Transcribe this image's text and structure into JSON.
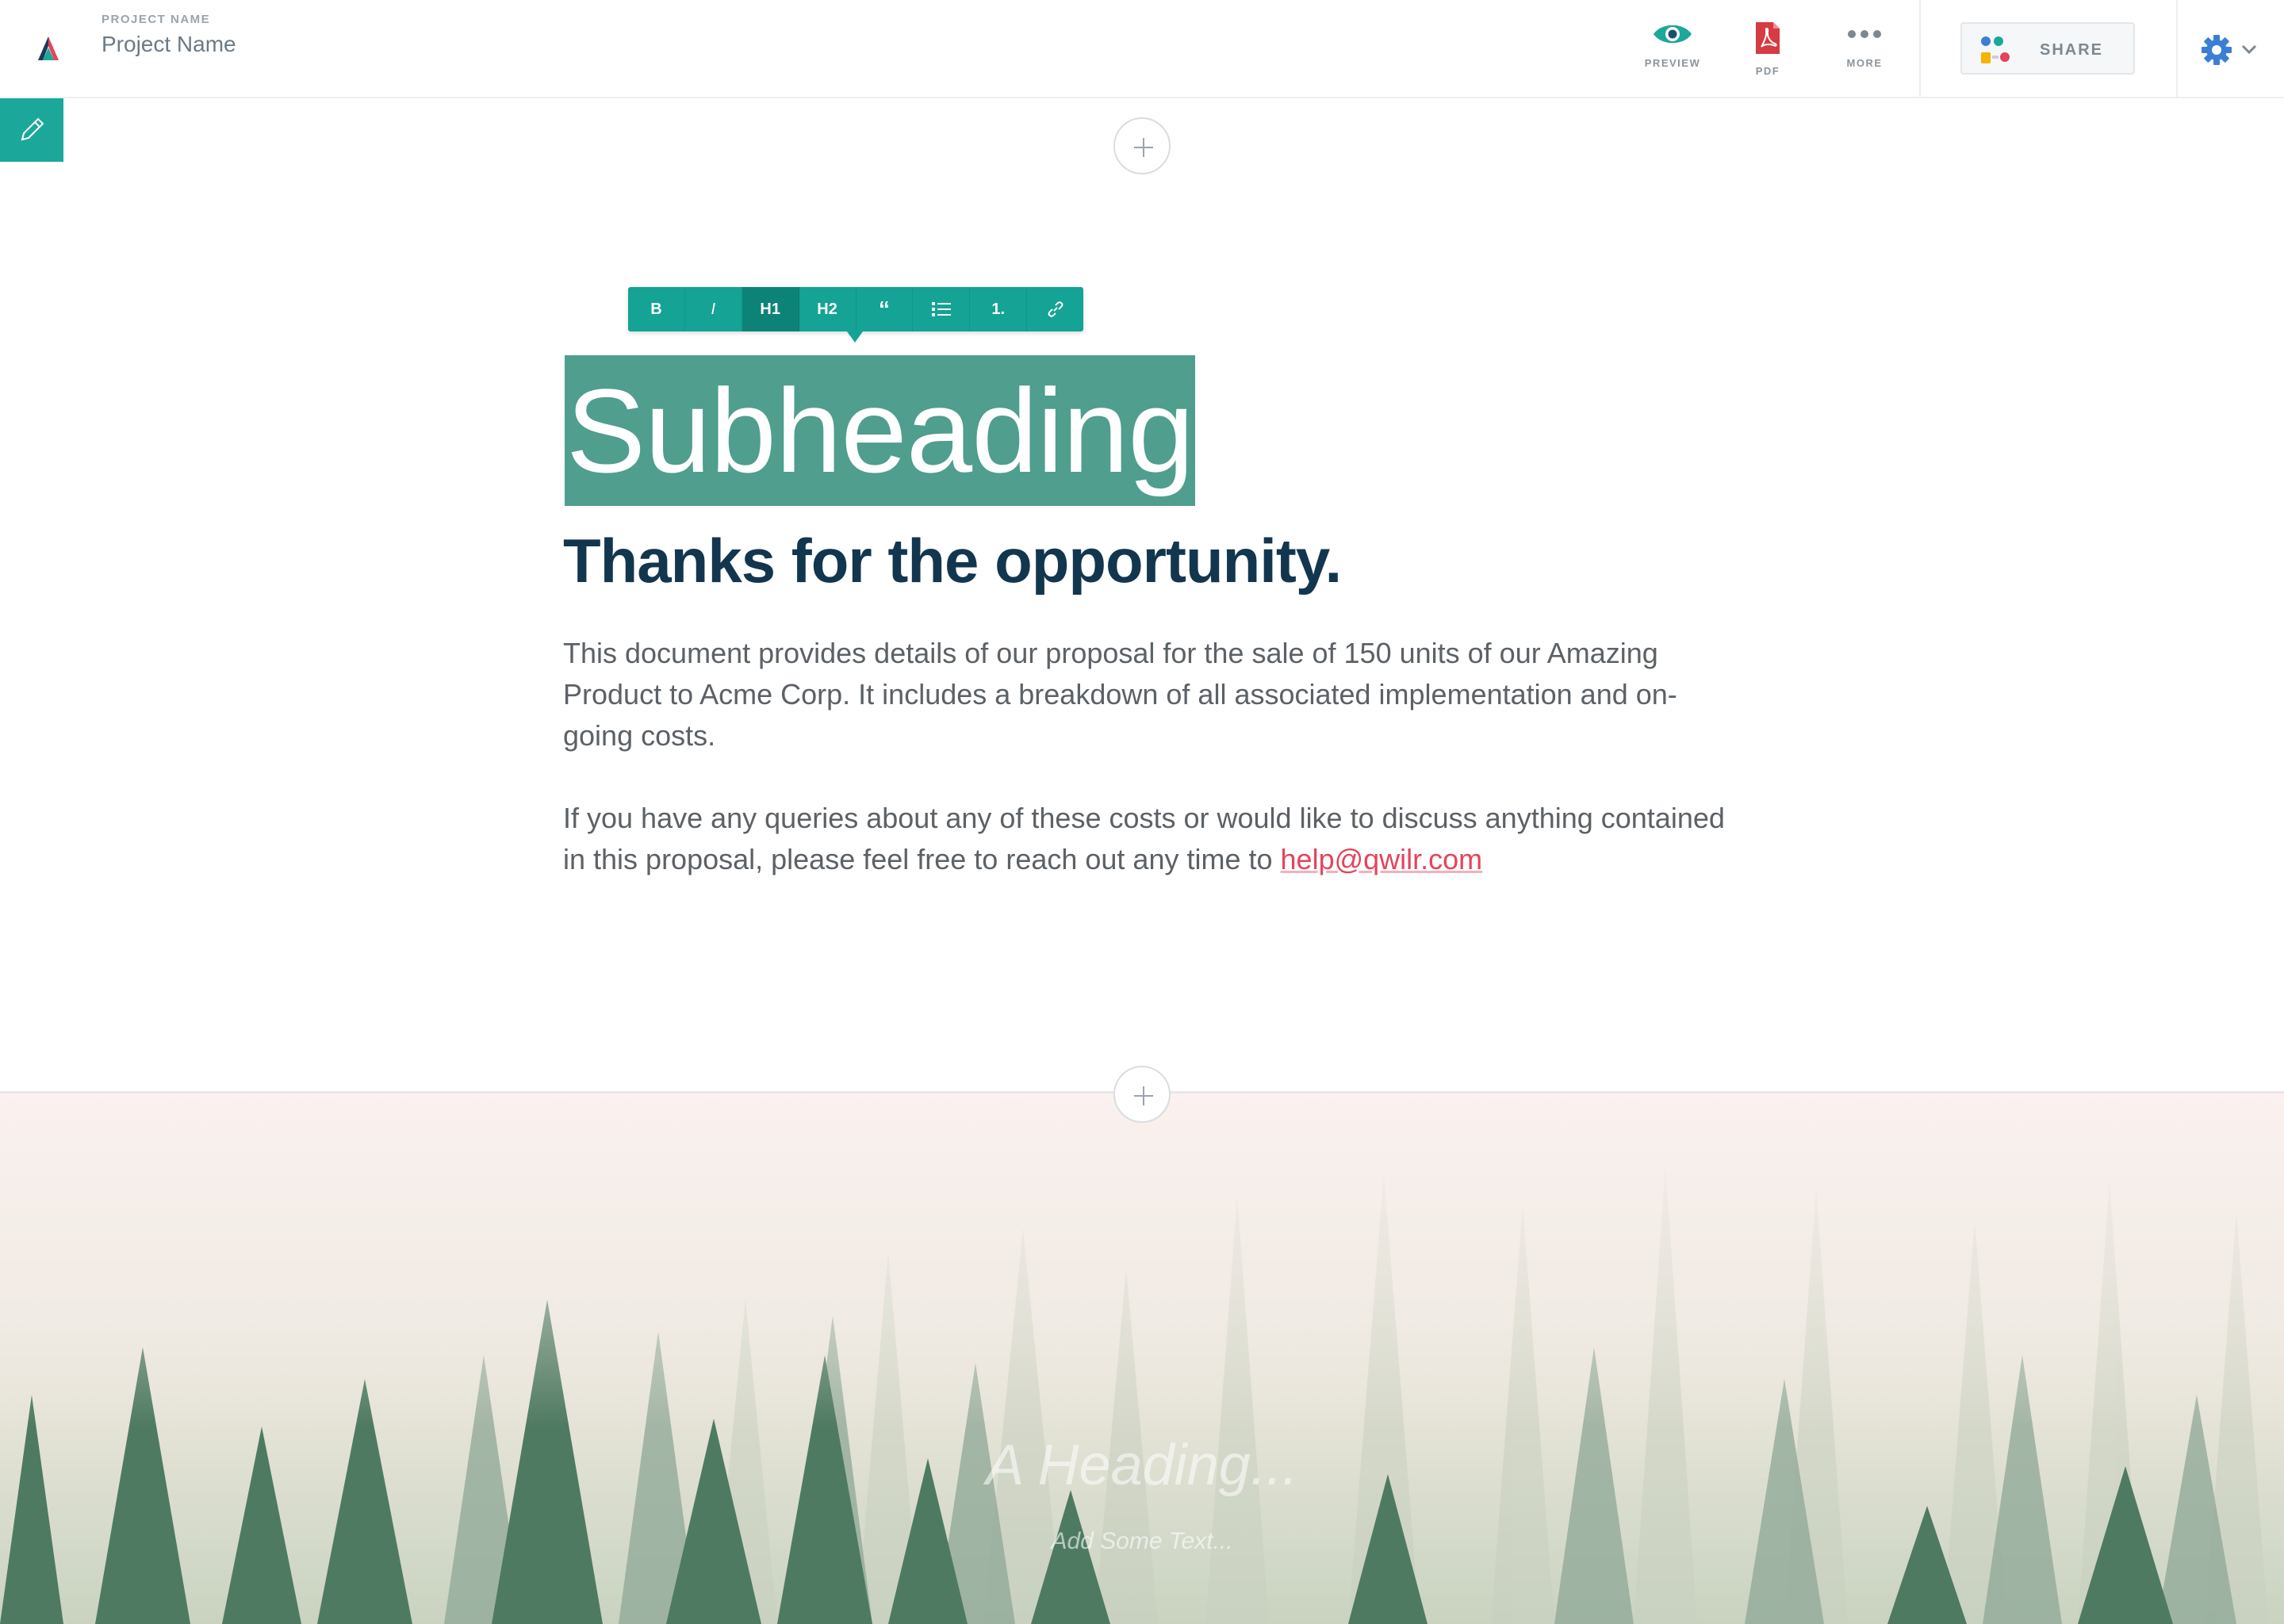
{
  "header": {
    "project_label": "PROJECT NAME",
    "project_name": "Project Name",
    "actions": {
      "preview": "PREVIEW",
      "pdf": "PDF",
      "more": "MORE"
    },
    "share_label": "SHARE"
  },
  "toolbar": {
    "bold": "B",
    "italic": "I",
    "h1": "H1",
    "h2": "H2",
    "quote": "“",
    "numbered": "1."
  },
  "content": {
    "subheading": "Subheading",
    "heading": "Thanks for the opportunity.",
    "paragraph1": "This document provides details of our proposal for the sale of 150 units of our Amazing Product to Acme Corp. It includes a breakdown of all associated implementation and on-going costs.",
    "paragraph2": "If you have any queries about any of these costs or would like to discuss anything contained in this proposal, please feel free to reach out any time to",
    "email": "help@qwilr.com"
  },
  "hero": {
    "heading_placeholder": "A Heading...",
    "text_placeholder": "Add Some Text..."
  },
  "colors": {
    "accent": "#1ba89a",
    "heading": "#13364f",
    "link": "#e5445b",
    "selection": "#4f9e8e"
  }
}
